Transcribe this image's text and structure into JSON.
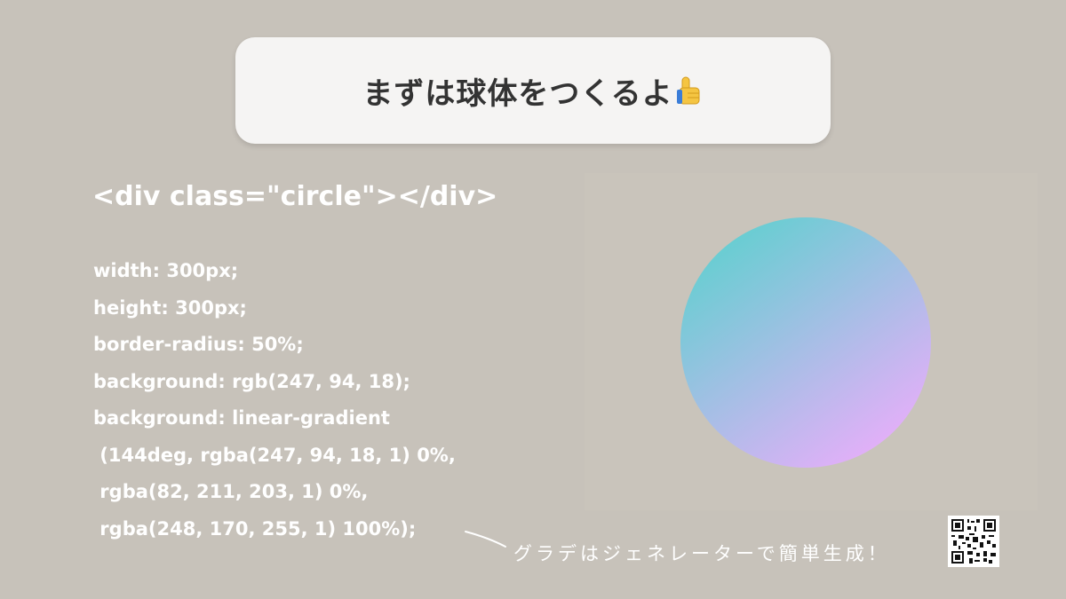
{
  "title": {
    "text": "まずは球体をつくるよ",
    "emoji_icon": "thumbs-up-icon"
  },
  "html_code": "<div class=\"circle\"></div>",
  "css_code": [
    "width: 300px;",
    "height: 300px;",
    "border-radius: 50%;",
    "background: rgb(247, 94, 18);",
    "background: linear-gradient",
    " (144deg, rgba(247, 94, 18, 1) 0%,",
    " rgba(82, 211, 203, 1) 0%,",
    " rgba(248, 170, 255, 1) 100%);"
  ],
  "note": "グラデはジェネレーターで簡単生成！",
  "colors": {
    "background": "#c7c2ba",
    "card": "#f5f4f3",
    "title_text": "#333333",
    "code_text": "#ffffff",
    "gradient_start": "#52d3cb",
    "gradient_end": "#f8aaff"
  }
}
